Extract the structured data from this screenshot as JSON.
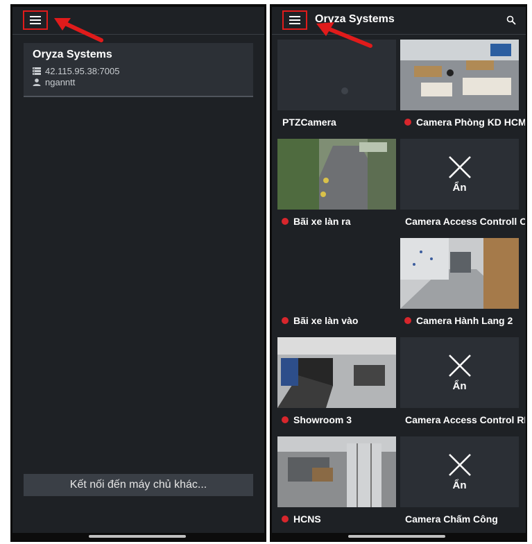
{
  "left_screen": {
    "server": {
      "name": "Oryza Systems",
      "address": "42.115.95.38:7005",
      "user": "nganntt"
    },
    "connect_button_label": "Kết nối đến máy chủ khác..."
  },
  "right_screen": {
    "title": "Oryza Systems",
    "cameras": [
      {
        "name": "PTZCamera",
        "status_dot": false,
        "thumbnail": "loading"
      },
      {
        "name": "Camera Phòng KD HCM",
        "status_dot": true,
        "thumbnail": "office"
      },
      {
        "name": "Bãi xe làn ra",
        "status_dot": true,
        "thumbnail": "driveway"
      },
      {
        "name": "Camera Access Controll OS",
        "status_dot": false,
        "thumbnail": "hidden",
        "hidden_label": "Ẩn"
      },
      {
        "name": "Bãi xe làn vào",
        "status_dot": true,
        "thumbnail": "blank"
      },
      {
        "name": "Camera Hành Lang 2",
        "status_dot": true,
        "thumbnail": "hallway"
      },
      {
        "name": "Showroom 3",
        "status_dot": true,
        "thumbnail": "showroom"
      },
      {
        "name": "Camera Access Control RD",
        "status_dot": false,
        "thumbnail": "hidden",
        "hidden_label": "Ẩn"
      },
      {
        "name": "HCNS",
        "status_dot": true,
        "thumbnail": "office2"
      },
      {
        "name": "Camera Chấm Công",
        "status_dot": false,
        "thumbnail": "hidden",
        "hidden_label": "Ẩn"
      }
    ]
  },
  "colors": {
    "background": "#1e2125",
    "card": "#2c3036",
    "status_dot": "#d8262c",
    "highlight": "#e01b1b"
  },
  "icons": [
    "menu-icon",
    "search-icon",
    "server-icon",
    "user-icon",
    "close-x-icon",
    "red-arrow"
  ]
}
